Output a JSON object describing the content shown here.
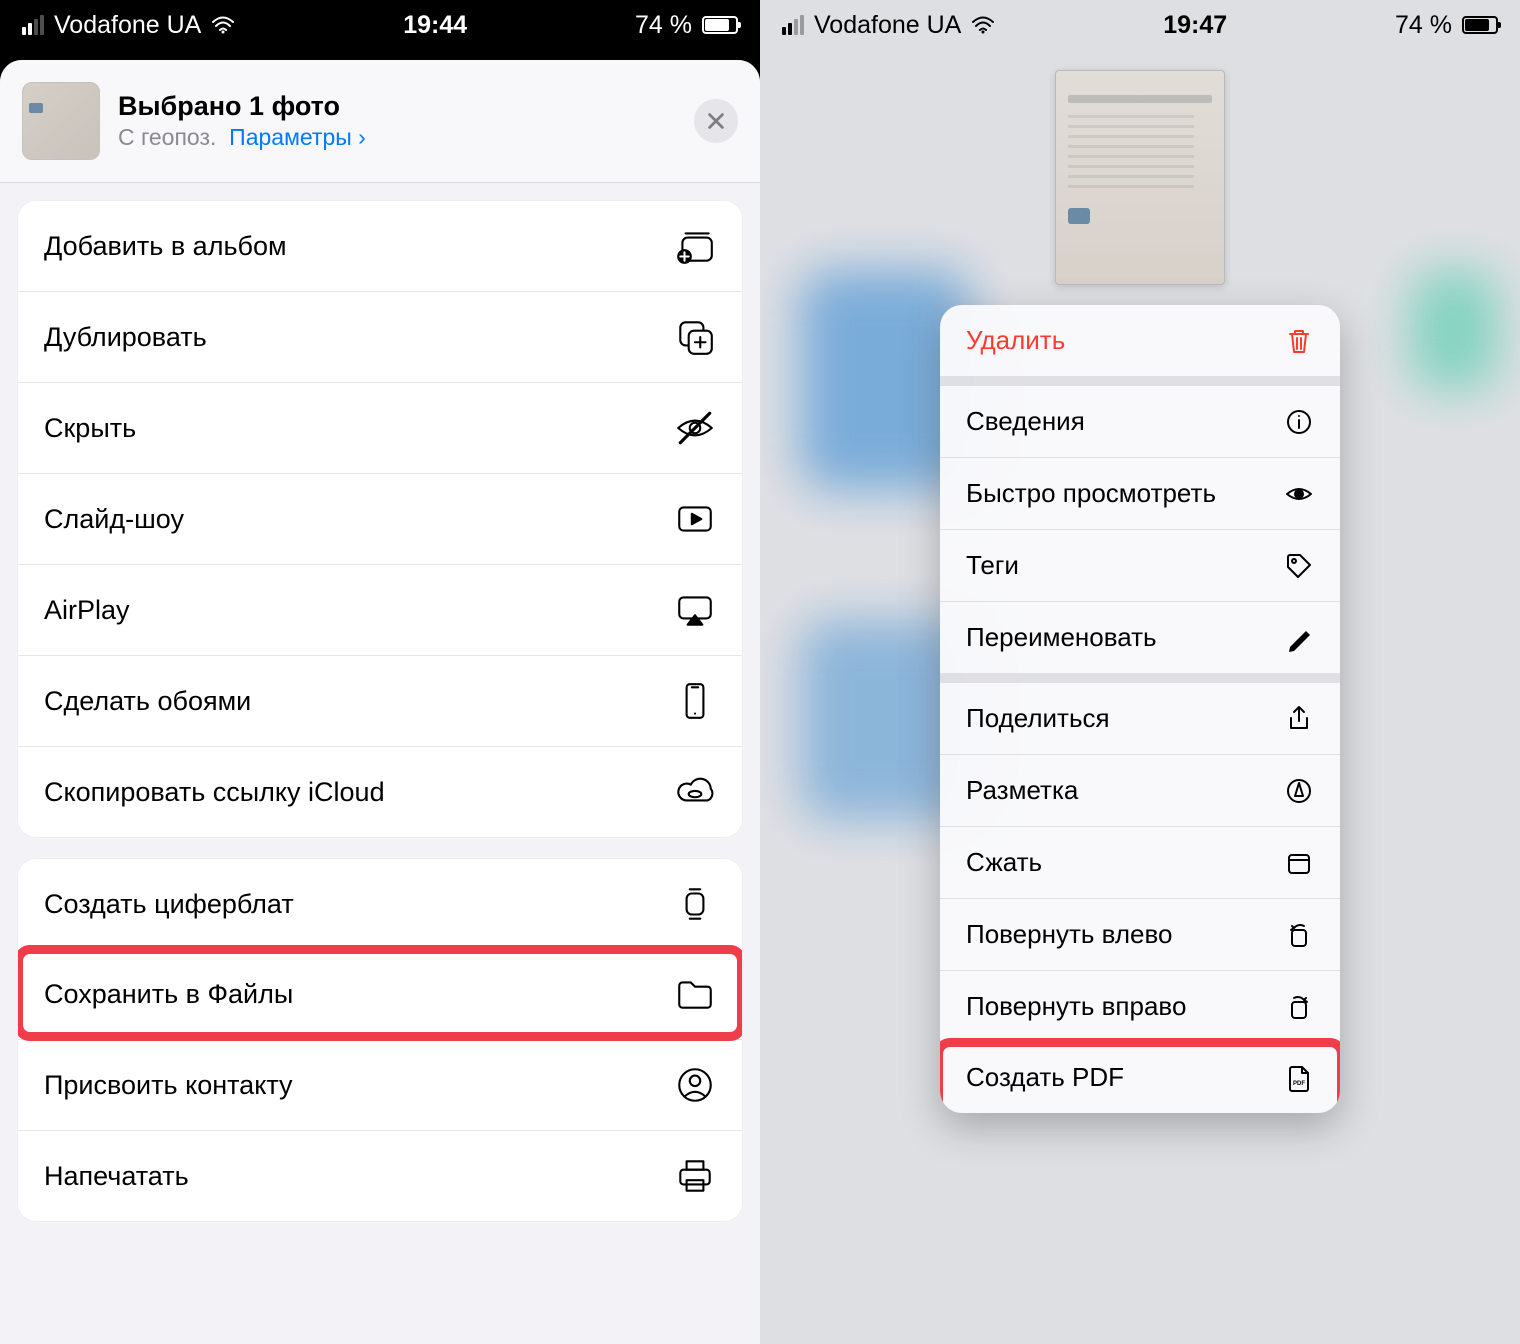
{
  "left": {
    "status": {
      "carrier": "Vodafone UA",
      "time": "19:44",
      "battery_pct": "74 %"
    },
    "header": {
      "title": "Выбрано 1 фото",
      "subtitle_prefix": "С геопоз.",
      "params_label": "Параметры",
      "params_chevron": "›"
    },
    "groups": [
      {
        "rows": [
          {
            "id": "add-to-album",
            "label": "Добавить в альбом",
            "icon": "album-add-icon"
          },
          {
            "id": "duplicate",
            "label": "Дублировать",
            "icon": "duplicate-icon"
          },
          {
            "id": "hide",
            "label": "Скрыть",
            "icon": "eye-off-icon"
          },
          {
            "id": "slideshow",
            "label": "Слайд-шоу",
            "icon": "play-rect-icon"
          },
          {
            "id": "airplay",
            "label": "AirPlay",
            "icon": "airplay-icon"
          },
          {
            "id": "wallpaper",
            "label": "Сделать обоями",
            "icon": "phone-icon"
          },
          {
            "id": "copy-icloud-link",
            "label": "Скопировать ссылку iCloud",
            "icon": "cloud-link-icon"
          }
        ]
      },
      {
        "rows": [
          {
            "id": "watch-face",
            "label": "Создать циферблат",
            "icon": "watch-icon"
          },
          {
            "id": "save-to-files",
            "label": "Сохранить в Файлы",
            "icon": "folder-icon",
            "highlight": true
          },
          {
            "id": "assign-contact",
            "label": "Присвоить контакту",
            "icon": "contact-icon"
          },
          {
            "id": "print",
            "label": "Напечатать",
            "icon": "printer-icon"
          }
        ]
      }
    ]
  },
  "right": {
    "status": {
      "carrier": "Vodafone UA",
      "time": "19:47",
      "battery_pct": "74 %"
    },
    "menu": {
      "groups": [
        {
          "rows": [
            {
              "id": "delete",
              "label": "Удалить",
              "icon": "trash-icon",
              "destructive": true
            }
          ]
        },
        {
          "rows": [
            {
              "id": "info",
              "label": "Сведения",
              "icon": "info-icon"
            },
            {
              "id": "quicklook",
              "label": "Быстро просмотреть",
              "icon": "eye-icon"
            },
            {
              "id": "tags",
              "label": "Теги",
              "icon": "tag-icon"
            },
            {
              "id": "rename",
              "label": "Переименовать",
              "icon": "pencil-icon"
            }
          ]
        },
        {
          "rows": [
            {
              "id": "share",
              "label": "Поделиться",
              "icon": "share-icon"
            },
            {
              "id": "markup",
              "label": "Разметка",
              "icon": "markup-icon"
            },
            {
              "id": "compress",
              "label": "Сжать",
              "icon": "archive-icon"
            },
            {
              "id": "rotate-left",
              "label": "Повернуть влево",
              "icon": "rotate-left-icon"
            },
            {
              "id": "rotate-right",
              "label": "Повернуть вправо",
              "icon": "rotate-right-icon"
            },
            {
              "id": "create-pdf",
              "label": "Создать PDF",
              "icon": "pdf-icon",
              "highlight": true
            }
          ]
        }
      ]
    }
  },
  "colors": {
    "highlight": "#f03d4a",
    "ios_blue": "#007aff",
    "ios_red": "#ff3b30"
  }
}
